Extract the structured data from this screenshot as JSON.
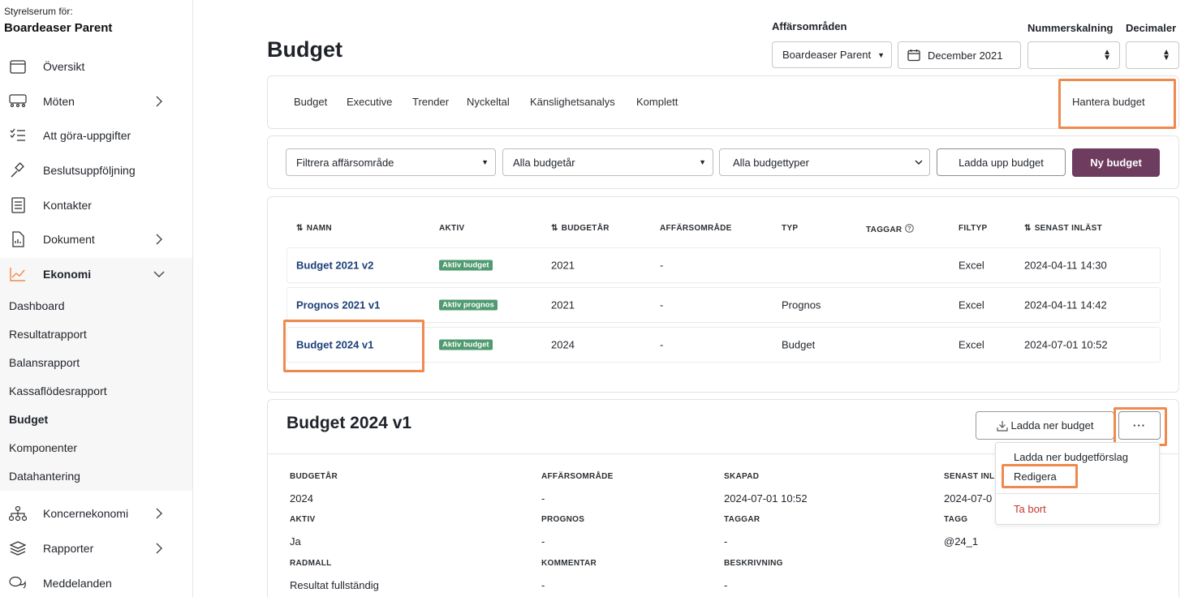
{
  "sidebar": {
    "org_label": "Styrelserum för:",
    "org_name": "Boardeaser Parent",
    "items": [
      {
        "label": "Översikt"
      },
      {
        "label": "Möten"
      },
      {
        "label": "Att göra-uppgifter"
      },
      {
        "label": "Beslutsuppföljning"
      },
      {
        "label": "Kontakter"
      },
      {
        "label": "Dokument"
      },
      {
        "label": "Ekonomi"
      },
      {
        "label": "Koncernekonomi"
      },
      {
        "label": "Rapporter"
      },
      {
        "label": "Meddelanden"
      }
    ],
    "sub_items": [
      {
        "label": "Dashboard"
      },
      {
        "label": "Resultatrapport"
      },
      {
        "label": "Balansrapport"
      },
      {
        "label": "Kassaflödesrapport"
      },
      {
        "label": "Budget"
      },
      {
        "label": "Komponenter"
      },
      {
        "label": "Datahantering"
      }
    ]
  },
  "header": {
    "title": "Budget",
    "business_area_label": "Affärsområden",
    "business_area_value": "Boardeaser Parent",
    "date_value": "December 2021",
    "scaling_label": "Nummerskalning",
    "decimals_label": "Decimaler"
  },
  "tabs": [
    {
      "label": "Budget"
    },
    {
      "label": "Executive"
    },
    {
      "label": "Trender"
    },
    {
      "label": "Nyckeltal"
    },
    {
      "label": "Känslighetsanalys"
    },
    {
      "label": "Komplett"
    }
  ],
  "manage_budget_label": "Hantera budget",
  "filters": {
    "business_area": "Filtrera affärsområde",
    "year": "Alla budgetår",
    "type": "Alla budgettyper",
    "upload_label": "Ladda upp budget",
    "new_label": "Ny budget"
  },
  "table": {
    "columns": [
      "NAMN",
      "AKTIV",
      "BUDGETÅR",
      "AFFÄRSOMRÅDE",
      "TYP",
      "TAGGAR",
      "FILTYP",
      "SENAST INLÄST"
    ],
    "rows": [
      {
        "name": "Budget 2021 v2",
        "active": "Aktiv budget",
        "year": "2021",
        "area": "-",
        "type": "",
        "filetype": "Excel",
        "loaded": "2024-04-11 14:30"
      },
      {
        "name": "Prognos 2021 v1",
        "active": "Aktiv prognos",
        "year": "2021",
        "area": "-",
        "type": "Prognos",
        "filetype": "Excel",
        "loaded": "2024-04-11 14:42"
      },
      {
        "name": "Budget 2024 v1",
        "active": "Aktiv budget",
        "year": "2024",
        "area": "-",
        "type": "Budget",
        "filetype": "Excel",
        "loaded": "2024-07-01 10:52"
      }
    ]
  },
  "detail": {
    "title": "Budget 2024 v1",
    "download_label": "Ladda ner budget",
    "more_label": "···",
    "fields": {
      "budgetar_label": "BUDGETÅR",
      "budgetar": "2024",
      "area_label": "AFFÄRSOMRÅDE",
      "area": "-",
      "created_label": "SKAPAD",
      "created": "2024-07-01 10:52",
      "loaded_label": "SENAST INL",
      "loaded": "2024-07-0",
      "active_label": "AKTIV",
      "active": "Ja",
      "forecast_label": "PROGNOS",
      "forecast": "-",
      "tags_label": "TAGGAR",
      "tags": "-",
      "tag_label": "TAGG",
      "tag": "@24_1",
      "template_label": "RADMALL",
      "template": "Resultat fullständig",
      "comment_label": "KOMMENTAR",
      "comment": "-",
      "description_label": "BESKRIVNING",
      "description": "-"
    }
  },
  "dropdown": {
    "items": [
      {
        "label": "Ladda ner budgetförslag"
      },
      {
        "label": "Redigera"
      },
      {
        "label": "Ta bort"
      }
    ]
  },
  "colors": {
    "accent": "#6d3c5e",
    "highlight": "#ee8a4e",
    "badge": "#4f9a6e",
    "link": "#1d3f78",
    "danger": "#c0392b"
  }
}
